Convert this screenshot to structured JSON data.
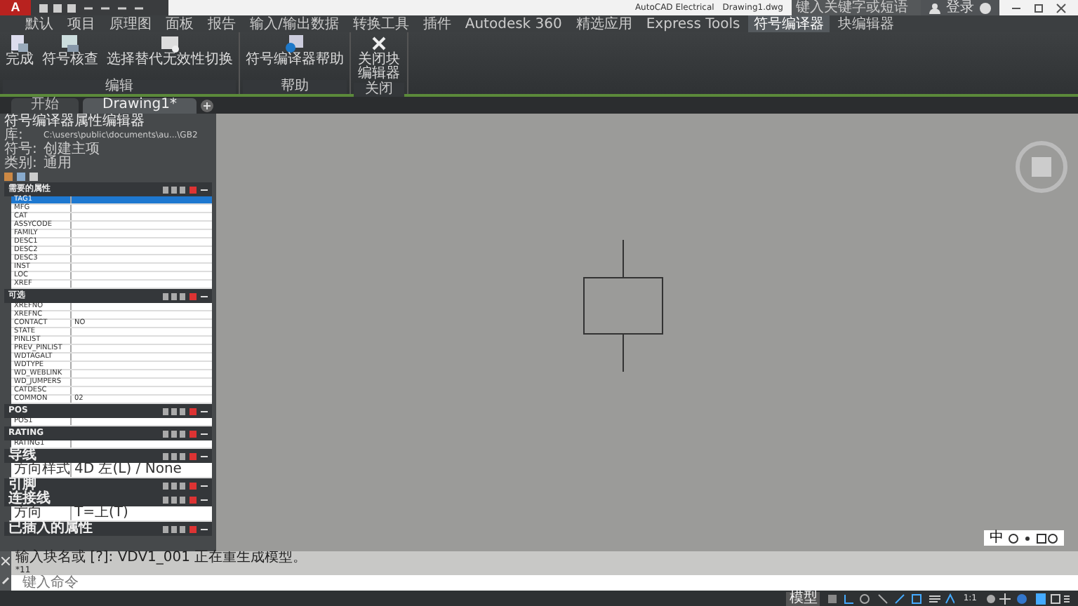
{
  "title_bar": {
    "logo": "A",
    "app": "AutoCAD Electrical",
    "file": "Drawing1.dwg",
    "search_placeholder": "键入关键字或短语",
    "user": "登录"
  },
  "ribbon_tabs": [
    {
      "label": "默认",
      "selected": false
    },
    {
      "label": "项目",
      "selected": false
    },
    {
      "label": "原理图",
      "selected": false
    },
    {
      "label": "面板",
      "selected": false
    },
    {
      "label": "报告",
      "selected": false
    },
    {
      "label": "输入/输出数据",
      "selected": false
    },
    {
      "label": "转换工具",
      "selected": false
    },
    {
      "label": "插件",
      "selected": false
    },
    {
      "label": "Autodesk 360",
      "selected": false
    },
    {
      "label": "精选应用",
      "selected": false
    },
    {
      "label": "Express Tools",
      "selected": false
    },
    {
      "label": "符号编译器",
      "selected": true
    },
    {
      "label": "块编辑器",
      "selected": false
    }
  ],
  "ribbon_panels": [
    {
      "title": "编辑",
      "buttons": [
        {
          "label": "完成",
          "kind": "finish"
        },
        {
          "label": "符号核查",
          "kind": "audit"
        },
        {
          "label": "选择替代无效性切换",
          "kind": "toggle"
        }
      ]
    },
    {
      "title": "帮助",
      "buttons": [
        {
          "label": "符号编译器帮助",
          "kind": "help"
        }
      ]
    },
    {
      "title": "关闭",
      "buttons": [
        {
          "label": "关闭块编辑器",
          "kind": "close"
        }
      ]
    }
  ],
  "document_tabs": [
    {
      "label": "开始",
      "selected": false
    },
    {
      "label": "Drawing1*",
      "selected": true
    }
  ],
  "properties_panel": {
    "title": "符号编译器属性编辑器",
    "info": [
      {
        "label": "库:",
        "value": "C:\\users\\public\\documents\\au...\\GB2"
      },
      {
        "label": "符号:",
        "value": "创建主项"
      },
      {
        "label": "类别:",
        "value": "通用"
      }
    ],
    "sections": [
      {
        "title": "需要的属性",
        "kind": "attributes",
        "rows": [
          {
            "name": "TAG1",
            "value": "",
            "selected": true
          },
          {
            "name": "MFG",
            "value": "",
            "selected": false
          },
          {
            "name": "CAT",
            "value": "",
            "selected": false
          },
          {
            "name": "ASSYCODE",
            "value": "",
            "selected": false
          },
          {
            "name": "FAMILY",
            "value": "",
            "selected": false
          },
          {
            "name": "DESC1",
            "value": "",
            "selected": false
          },
          {
            "name": "DESC2",
            "value": "",
            "selected": false
          },
          {
            "name": "DESC3",
            "value": "",
            "selected": false
          },
          {
            "name": "INST",
            "value": "",
            "selected": false
          },
          {
            "name": "LOC",
            "value": "",
            "selected": false
          },
          {
            "name": "XREF",
            "value": "",
            "selected": false
          }
        ]
      },
      {
        "title": "可选",
        "kind": "attributes",
        "rows": [
          {
            "name": "XREFNO",
            "value": "",
            "selected": false
          },
          {
            "name": "XREFNC",
            "value": "",
            "selected": false
          },
          {
            "name": "CONTACT",
            "value": "NO",
            "selected": false
          },
          {
            "name": "STATE",
            "value": "",
            "selected": false
          },
          {
            "name": "PINLIST",
            "value": "",
            "selected": false
          },
          {
            "name": "PREV_PINLIST",
            "value": "",
            "selected": false
          },
          {
            "name": "WDTAGALT",
            "value": "",
            "selected": false
          },
          {
            "name": "WDTYPE",
            "value": "",
            "selected": false
          },
          {
            "name": "WD_WEBLINK",
            "value": "",
            "selected": false
          },
          {
            "name": "WD_JUMPERS",
            "value": "",
            "selected": false
          },
          {
            "name": "CATDESC",
            "value": "",
            "selected": false
          },
          {
            "name": "COMMON",
            "value": "02",
            "selected": false
          }
        ]
      },
      {
        "title": "POS",
        "kind": "attributes",
        "rows": [
          {
            "name": "POS1",
            "value": "",
            "selected": false
          }
        ]
      },
      {
        "title": "RATING",
        "kind": "attributes",
        "rows": [
          {
            "name": "RATING1",
            "value": "",
            "selected": false
          }
        ]
      },
      {
        "title": "导线",
        "kind": "settings",
        "rows": [
          {
            "name": "方向样式",
            "value": "4D 左(L) / None",
            "selected": false
          }
        ]
      },
      {
        "title": "引脚",
        "kind": "settings"
      },
      {
        "title": "连接线",
        "kind": "settings",
        "rows": [
          {
            "name": "方向",
            "value": "T=上(T)",
            "selected": false
          }
        ]
      },
      {
        "title": "已插入的属性",
        "kind": "settings"
      }
    ]
  },
  "command_line": {
    "history": [
      "输入块名或 [?]: VDV1_001 正在重生成模型。",
      "*11"
    ],
    "prompt_placeholder": "键入命令"
  },
  "ime_bar": {
    "mode": "中"
  },
  "status_bar": {
    "model": "模型",
    "scale": "1:1"
  }
}
